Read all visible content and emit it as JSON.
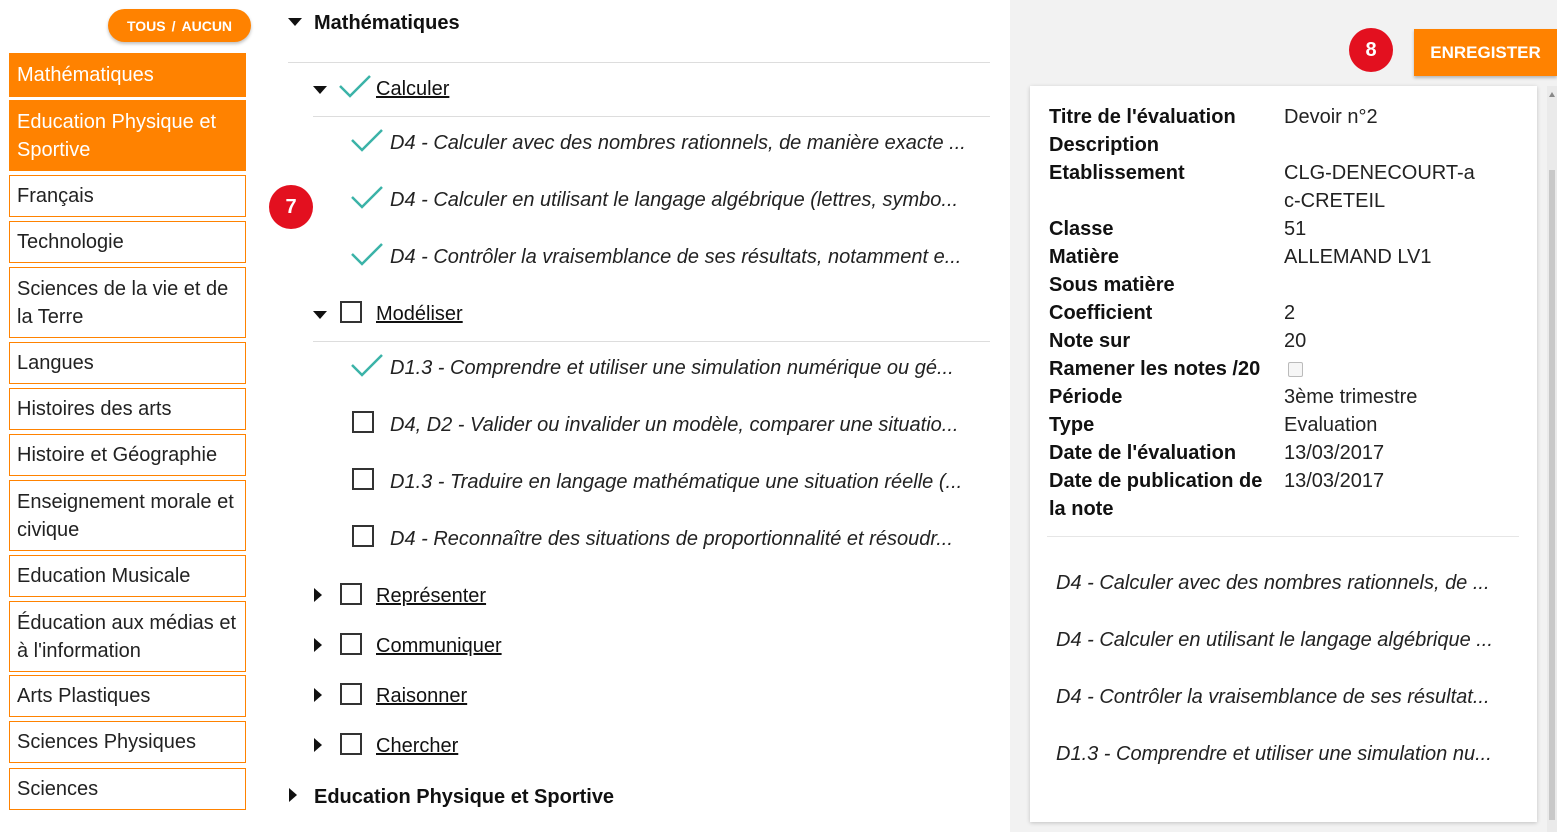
{
  "sidebar": {
    "toggle": {
      "all": "TOUS",
      "sep": "/",
      "none": "AUCUN"
    },
    "subjects": [
      {
        "label": "Mathématiques",
        "active": true
      },
      {
        "label": "Education Physique et Sportive",
        "active": true
      },
      {
        "label": "Français",
        "active": false
      },
      {
        "label": "Technologie",
        "active": false
      },
      {
        "label": "Sciences de la vie et de la Terre",
        "active": false
      },
      {
        "label": "Langues",
        "active": false
      },
      {
        "label": "Histoires des arts",
        "active": false
      },
      {
        "label": "Histoire et Géographie",
        "active": false
      },
      {
        "label": "Enseignement morale et civique",
        "active": false
      },
      {
        "label": "Education Musicale",
        "active": false
      },
      {
        "label": "Éducation aux médias et à l'information",
        "active": false
      },
      {
        "label": "Arts Plastiques",
        "active": false
      },
      {
        "label": "Sciences Physiques",
        "active": false
      },
      {
        "label": "Sciences",
        "active": false
      }
    ]
  },
  "tree": {
    "math_title": "Mathématiques",
    "domains": [
      {
        "label": "Calculer",
        "expanded": true,
        "checked": true,
        "skills": [
          {
            "label": "D4 - Calculer avec des nombres rationnels, de manière exacte ...",
            "checked": true
          },
          {
            "label": "D4 - Calculer en utilisant le langage algébrique (lettres, symbo...",
            "checked": true
          },
          {
            "label": "D4 - Contrôler la vraisemblance de ses résultats, notamment e...",
            "checked": true
          }
        ]
      },
      {
        "label": "Modéliser",
        "expanded": true,
        "checked": false,
        "skills": [
          {
            "label": "D1.3 - Comprendre et utiliser une simulation numérique ou gé...",
            "checked": true
          },
          {
            "label": "D4, D2 - Valider ou invalider un modèle, comparer une situatio...",
            "checked": false
          },
          {
            "label": "D1.3 - Traduire en langage mathématique une situation réelle (...",
            "checked": false
          },
          {
            "label": "D4 - Reconnaître des situations de proportionnalité et résoudr...",
            "checked": false
          }
        ]
      },
      {
        "label": "Représenter",
        "expanded": false,
        "checked": false,
        "skills": []
      },
      {
        "label": "Communiquer",
        "expanded": false,
        "checked": false,
        "skills": []
      },
      {
        "label": "Raisonner",
        "expanded": false,
        "checked": false,
        "skills": []
      },
      {
        "label": "Chercher",
        "expanded": false,
        "checked": false,
        "skills": []
      }
    ],
    "eps_title": "Education Physique et Sportive",
    "badge7": "7"
  },
  "right": {
    "badge8": "8",
    "save_label": "ENREGISTER",
    "info": [
      {
        "key": "Titre de l'évaluation",
        "value": "Devoir n°2"
      },
      {
        "key": "Description",
        "value": ""
      },
      {
        "key": "Etablissement",
        "value": "CLG-DENECOURT-ac-CRETEIL"
      },
      {
        "key": "Classe",
        "value": "51"
      },
      {
        "key": "Matière",
        "value": "ALLEMAND LV1"
      },
      {
        "key": "Sous matière",
        "value": ""
      },
      {
        "key": "Coefficient",
        "value": "2"
      },
      {
        "key": "Note sur",
        "value": "20"
      },
      {
        "key": "Ramener les notes /20",
        "value": ""
      },
      {
        "key": "Période",
        "value": "3ème trimestre"
      },
      {
        "key": "Type",
        "value": "Evaluation"
      },
      {
        "key": "Date de l'évaluation",
        "value": "13/03/2017"
      },
      {
        "key": "Date de publication de la note",
        "value": "13/03/2017"
      }
    ],
    "ramener_checked": false,
    "summary": [
      "D4 - Calculer avec des nombres rationnels, de ...",
      "D4 - Calculer en utilisant le langage algébrique ...",
      "D4 - Contrôler la vraisemblance de ses résultat...",
      "D1.3 - Comprendre et utiliser une simulation nu..."
    ]
  },
  "colors": {
    "accent": "#ff8200",
    "check": "#3bb3a8",
    "badge": "#e3101f"
  }
}
